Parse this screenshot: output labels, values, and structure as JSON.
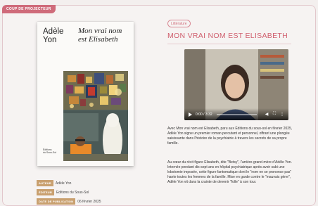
{
  "banner": {
    "label": "COUP DE PROJECTEUR"
  },
  "book": {
    "author_line1": "Adèle",
    "author_line2": "Yon",
    "title_line1": "Mon vrai nom",
    "title_line2": "est Elisabeth",
    "publisher_line1": "Éditions",
    "publisher_line2": "du Sous-Sol"
  },
  "meta": [
    {
      "label": "AUTEUR",
      "value": "Adèle Yon"
    },
    {
      "label": "ÉDITEUR",
      "value": "Editions du Sous-Sol"
    },
    {
      "label": "DATE DE PUBLICATION",
      "value": "06 février 2025"
    }
  ],
  "article": {
    "category": "Littérature",
    "title": "MON VRAI NOM EST ELISABETH",
    "video": {
      "time": "0:00 / 3:32"
    },
    "para1": "Avec Mon vrai nom est Elisabeth, paru aux Éditions du sous-sol en février 2025, Adèle Yon signe un premier roman percutant et personnel, offrant une plongée saisissante dans l'histoire de la psychiatrie à travers les secrets de sa propre famille.",
    "para2": "Au cœur du récit figure Elisabeth, dite \"Betsy\", l'arrière-grand-mère d'Adèle Yon. Internée pendant dix-sept ans en hôpital psychiatrique après avoir subi une lobotomie imposée, cette figure fantomatique dont le \"nom ne se prononce pas\" hante toutes les femmes de la famille. Mise en garde contre le \"mauvais gène\", Adèle Yon vit dans la crainte de devenir \"folle\" à son tour."
  },
  "colors": {
    "accent": "#d0606f",
    "label_bg": "#c9a06f"
  }
}
